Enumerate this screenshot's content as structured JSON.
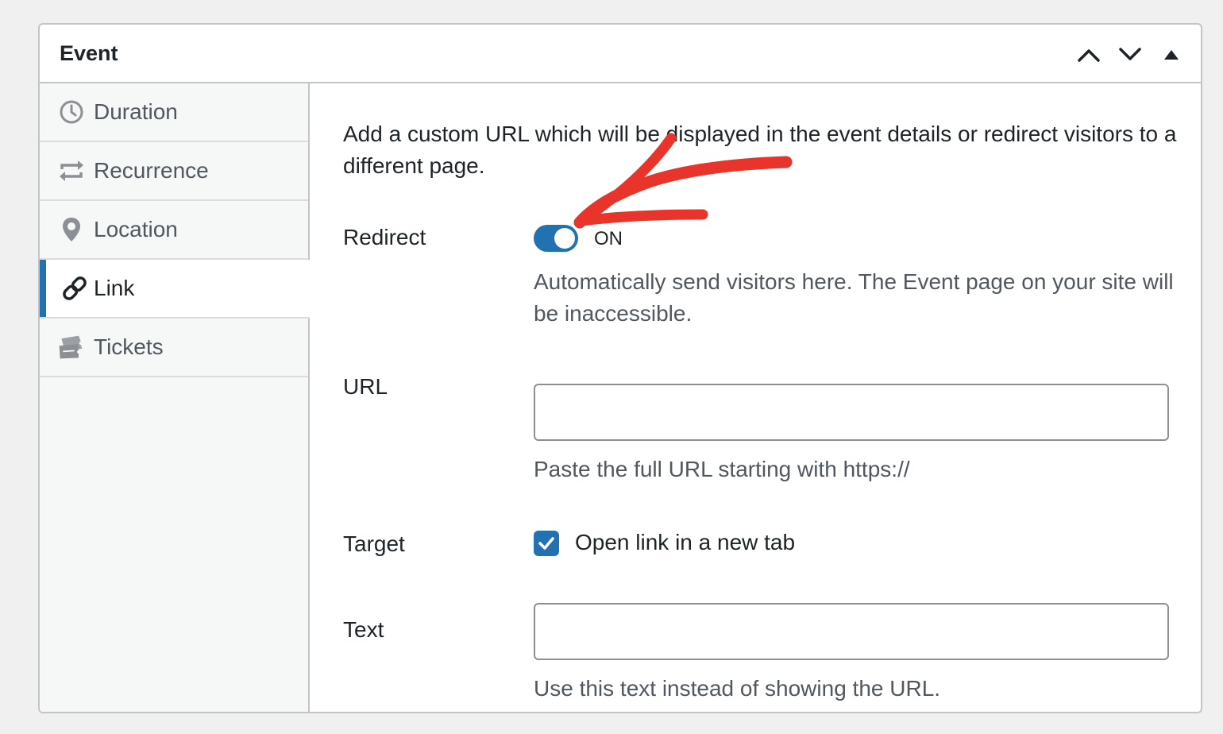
{
  "panel": {
    "title": "Event",
    "actions": [
      {
        "name": "move-up",
        "icon": "chevron-up-icon"
      },
      {
        "name": "move-down",
        "icon": "chevron-down-icon"
      },
      {
        "name": "collapse",
        "icon": "triangle-up-icon"
      }
    ]
  },
  "sidebar": {
    "items": [
      {
        "label": "Duration",
        "icon": "clock-icon",
        "active": false
      },
      {
        "label": "Recurrence",
        "icon": "repeat-icon",
        "active": false
      },
      {
        "label": "Location",
        "icon": "location-pin-icon",
        "active": false
      },
      {
        "label": "Link",
        "icon": "link-icon",
        "active": true
      },
      {
        "label": "Tickets",
        "icon": "tickets-icon",
        "active": false
      }
    ]
  },
  "content": {
    "intro": "Add a custom URL which will be displayed in the event details or redirect visitors to a different page.",
    "redirect": {
      "label": "Redirect",
      "state": "ON",
      "description": "Automatically send visitors here. The Event page on your site will be inaccessible."
    },
    "url": {
      "label": "URL",
      "value": "",
      "description": "Paste the full URL starting with https://"
    },
    "target": {
      "label": "Target",
      "checkbox_label": "Open link in a new tab",
      "checked": true
    },
    "text": {
      "label": "Text",
      "value": "",
      "description": "Use this text instead of showing the URL."
    }
  },
  "colors": {
    "accent": "#2271b1",
    "annotation": "#e8342a",
    "border": "#c3c4c7",
    "sidebar_bg": "#f6f7f7",
    "muted_text": "#50575e"
  }
}
